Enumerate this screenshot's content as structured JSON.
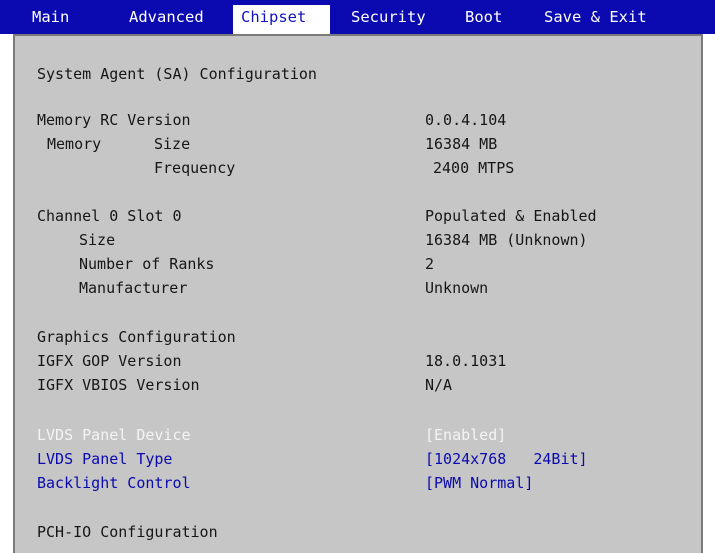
{
  "menu": {
    "tabs": [
      {
        "label": "Main"
      },
      {
        "label": "Advanced"
      },
      {
        "label": "Chipset"
      },
      {
        "label": "Security"
      },
      {
        "label": "Boot"
      },
      {
        "label": "Save & Exit"
      }
    ],
    "active_tab": "Chipset"
  },
  "colors": {
    "menu_bar": "#0a0ab0",
    "panel_bg": "#c6c6c6",
    "option_text": "#0a0ab0",
    "highlight_text": "#f4f4f4"
  },
  "section_title": "System Agent (SA) Configuration",
  "memory": {
    "rc_version_label": "Memory RC Version",
    "rc_version_value": "0.0.4.104",
    "label": "Memory",
    "size_label": "Size",
    "size_value": "16384 MB",
    "frequency_label": "Frequency",
    "frequency_value": "2400 MTPS"
  },
  "channel": {
    "label": "Channel 0 Slot 0",
    "status": "Populated & Enabled",
    "size_label": "Size",
    "size_value": "16384 MB (Unknown)",
    "ranks_label": "Number of Ranks",
    "ranks_value": "2",
    "manufacturer_label": "Manufacturer",
    "manufacturer_value": "Unknown"
  },
  "graphics": {
    "heading": "Graphics Configuration",
    "gop_label": "IGFX GOP Version",
    "gop_value": "18.0.1031",
    "vbios_label": "IGFX VBIOS Version",
    "vbios_value": "N/A"
  },
  "lvds": {
    "device_label": "LVDS Panel Device",
    "device_value": "[Enabled]",
    "type_label": "LVDS Panel Type",
    "type_value": "[1024x768   24Bit]",
    "backlight_label": "Backlight Control",
    "backlight_value": "[PWM Normal]"
  },
  "pch": {
    "heading": "PCH-IO Configuration"
  }
}
